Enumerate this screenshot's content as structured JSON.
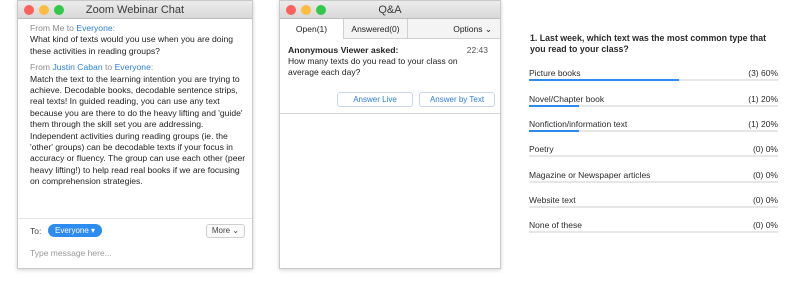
{
  "chat": {
    "title": "Zoom Webinar Chat",
    "messages": [
      {
        "from_prefix": "From ",
        "from": "Me",
        "to_word": " to ",
        "to": "Everyone",
        "suffix": ":",
        "text": "What kind of texts would you use when you are doing these activities in reading groups?"
      },
      {
        "from_prefix": "From ",
        "from": "Justin Caban",
        "to_word": " to ",
        "to": "Everyone",
        "suffix": ":",
        "text": "Match the text to the learning intention you are trying to achieve. Decodable books, decodable sentence strips, real texts! In guided reading, you can use any text because you are there to do the heavy lifting and 'guide' them through the skill set you are addressing. Independent activities during reading groups (ie. the 'other' groups) can be decodable texts if your focus in accuracy or fluency. The group can use each other (peer heavy lifting!) to help read real books if we are focusing on comprehension strategies."
      }
    ],
    "to_label": "To:",
    "recipient": "Everyone ▾",
    "more_label": "More ⌄",
    "input_placeholder": "Type message here..."
  },
  "qa": {
    "title": "Q&A",
    "tabs": [
      "Open(1)",
      "Answered(0)"
    ],
    "options_label": "Options ⌄",
    "question": {
      "asker": "Anonymous Viewer asked:",
      "time": "22:43",
      "text": "How many texts do you read to your class on average each day?"
    },
    "answer_live": "Answer Live",
    "answer_text": "Answer by Text"
  },
  "poll": {
    "question": "1. Last week, which text was the most common type that you read to your class?",
    "options": [
      {
        "label": "Picture books",
        "result": "(3) 60%",
        "fraction": 0.6
      },
      {
        "label": "Novel/Chapter book",
        "result": "(1) 20%",
        "fraction": 0.2
      },
      {
        "label": "Nonfiction/information text",
        "result": "(1) 20%",
        "fraction": 0.2
      },
      {
        "label": "Poetry",
        "result": "(0) 0%",
        "fraction": 0
      },
      {
        "label": "Magazine or Newspaper articles",
        "result": "(0) 0%",
        "fraction": 0
      },
      {
        "label": "Website text",
        "result": "(0) 0%",
        "fraction": 0
      },
      {
        "label": "None of these",
        "result": "(0) 0%",
        "fraction": 0
      }
    ]
  },
  "colors": {
    "accent": "#2d8cf0",
    "close": "#fc605c",
    "minimize": "#fdbc40",
    "zoom": "#34c84a"
  }
}
